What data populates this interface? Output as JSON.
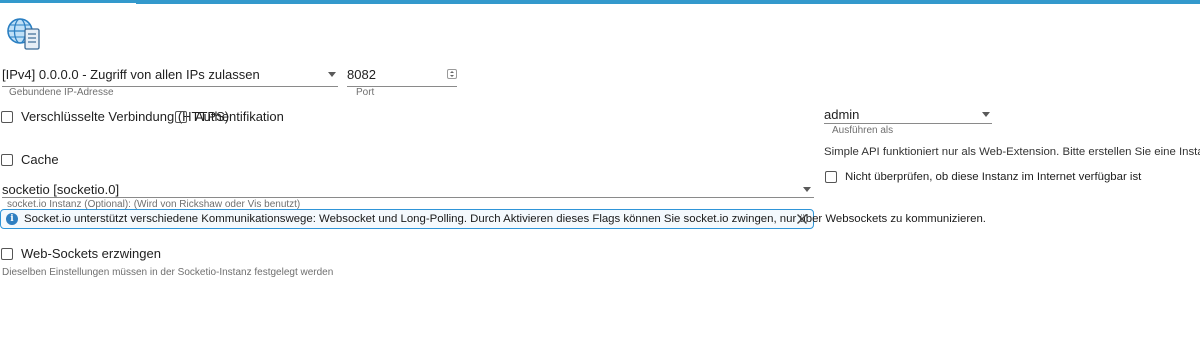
{
  "colors": {
    "accent": "#3399cc",
    "info_border": "#2f95d8"
  },
  "bind": {
    "value": "[IPv4] 0.0.0.0 - Zugriff von allen IPs zulassen",
    "label": "Gebundene IP-Adresse"
  },
  "port": {
    "value": "8082",
    "label": "Port"
  },
  "https": {
    "label": "Verschlüsselte Verbindung (HTTPS)"
  },
  "auth": {
    "label": "Authentifikation"
  },
  "cache": {
    "label": "Cache"
  },
  "socketio": {
    "value": "socketio [socketio.0]",
    "label": "socket.io Instanz (Optional): (Wird von Rickshaw oder Vis benutzt)"
  },
  "info": {
    "icon": "info-icon",
    "text": "Socket.io unterstützt verschiedene Kommunikationswege: Websocket und Long-Polling. Durch Aktivieren dieses Flags können Sie socket.io zwingen, nur über Websockets zu kommunizieren."
  },
  "websockets": {
    "label": "Web-Sockets erzwingen"
  },
  "socketio_note": "Dieselben Einstellungen müssen in der Socketio-Instanz festgelegt werden",
  "run_as": {
    "value": "admin",
    "label": "Ausführen als"
  },
  "simple_api_text": "Simple API funktioniert nur als Web-Extension. Bitte erstellen Sie eine Instanz und nehmen Sie",
  "no_check": {
    "label": "Nicht überprüfen, ob diese Instanz im Internet verfügbar ist"
  }
}
